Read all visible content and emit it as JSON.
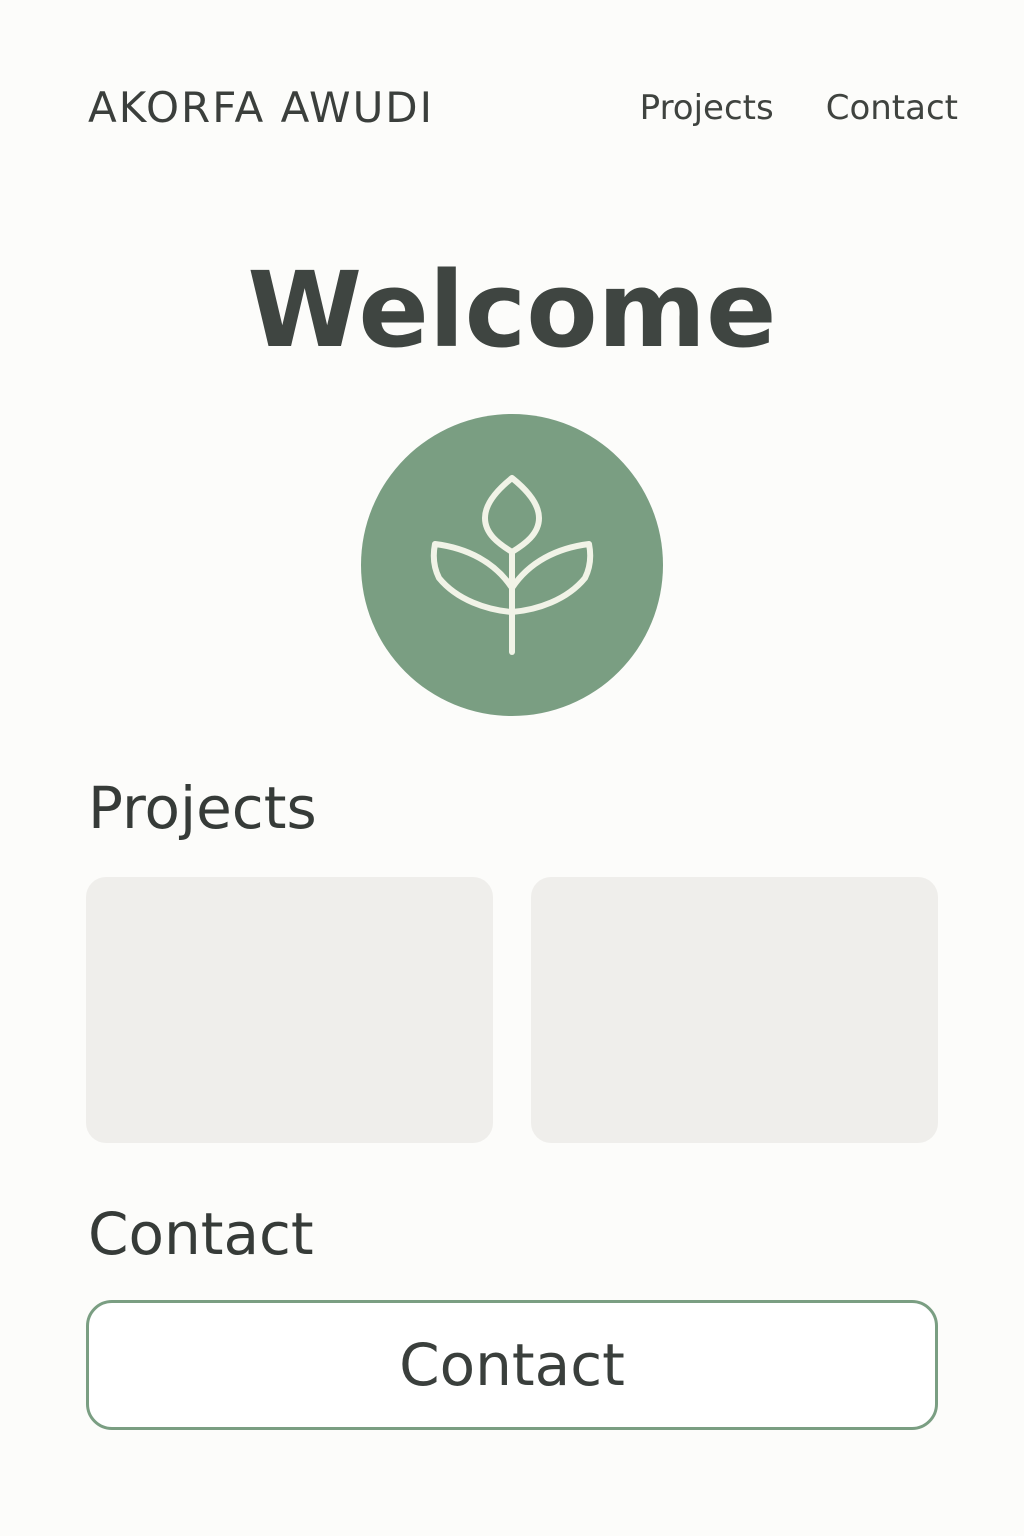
{
  "header": {
    "brand": "AKORFA AWUDI",
    "nav": [
      {
        "label": "Projects"
      },
      {
        "label": "Contact"
      }
    ]
  },
  "hero": {
    "title": "Welcome",
    "emblem_icon": "sprout-icon",
    "emblem_color": "#7a9e82",
    "emblem_icon_color": "#f1f3e7"
  },
  "projects": {
    "heading": "Projects",
    "card_color": "#efeeeb",
    "cards": [
      {
        "label": ""
      },
      {
        "label": ""
      }
    ]
  },
  "contact": {
    "heading": "Contact",
    "button_label": "Contact"
  }
}
